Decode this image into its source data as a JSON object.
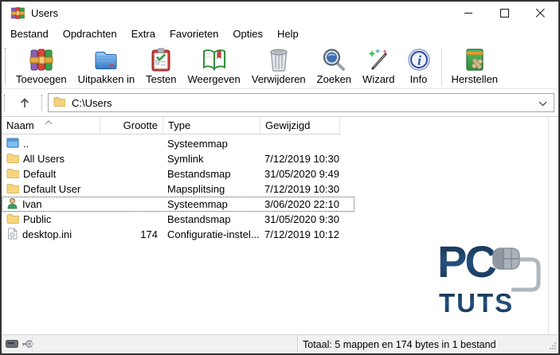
{
  "window": {
    "title": "Users"
  },
  "menu": {
    "items": [
      "Bestand",
      "Opdrachten",
      "Extra",
      "Favorieten",
      "Opties",
      "Help"
    ]
  },
  "toolbar": {
    "buttons": [
      {
        "label": "Toevoegen"
      },
      {
        "label": "Uitpakken in"
      },
      {
        "label": "Testen"
      },
      {
        "label": "Weergeven"
      },
      {
        "label": "Verwijderen"
      },
      {
        "label": "Zoeken"
      },
      {
        "label": "Wizard"
      },
      {
        "label": "Info"
      },
      {
        "label": "Herstellen"
      }
    ]
  },
  "addressbar": {
    "path": "C:\\Users"
  },
  "columns": [
    "Naam",
    "Grootte",
    "Type",
    "Gewijzigd"
  ],
  "files": [
    {
      "name": "..",
      "size": "",
      "type": "Systeemmap",
      "modified": ""
    },
    {
      "name": "All Users",
      "size": "",
      "type": "Symlink",
      "modified": "7/12/2019 10:30"
    },
    {
      "name": "Default",
      "size": "",
      "type": "Bestandsmap",
      "modified": "31/05/2020 9:49"
    },
    {
      "name": "Default User",
      "size": "",
      "type": "Mapsplitsing",
      "modified": "7/12/2019 10:30"
    },
    {
      "name": "Ivan",
      "size": "",
      "type": "Systeemmap",
      "modified": "3/06/2020 22:10"
    },
    {
      "name": "Public",
      "size": "",
      "type": "Bestandsmap",
      "modified": "31/05/2020 9:30"
    },
    {
      "name": "desktop.ini",
      "size": "174",
      "type": "Configuratie-instel...",
      "modified": "7/12/2019 10:12"
    }
  ],
  "statusbar": {
    "total": "Totaal: 5 mappen en 174 bytes in 1 bestand"
  },
  "watermark": {
    "line1": "PC",
    "line2": "TUTS"
  },
  "colors": {
    "accent_navy": "#1d3c63",
    "folder_yellow": "#f6d67c",
    "rar_red": "#d6453c",
    "rar_green": "#3aa04a",
    "rar_purple": "#8a5fb0"
  }
}
